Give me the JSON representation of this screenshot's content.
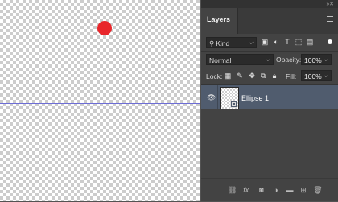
{
  "canvas": {
    "ellipse_color": "#e8262b",
    "guide_color": "#6d6dd6"
  },
  "panel": {
    "tab_label": "Layers",
    "collapse_icon": "double-chevron",
    "menu_icon": "hamburger-icon"
  },
  "filter": {
    "kind_label": "Kind",
    "icons": [
      "pixel-layer-filter-icon",
      "adjustment-layer-filter-icon",
      "type-layer-filter-icon",
      "shape-layer-filter-icon",
      "smart-object-filter-icon"
    ]
  },
  "blending": {
    "mode": "Normal",
    "opacity_label": "Opacity:",
    "opacity_value": "100%"
  },
  "lock": {
    "label": "Lock:",
    "fill_label": "Fill:",
    "fill_value": "100%"
  },
  "layers": [
    {
      "name": "Ellipse 1",
      "visible": true,
      "selected": true,
      "type": "shape"
    }
  ],
  "footer_icons": [
    "link-layers-icon",
    "fx-icon",
    "add-mask-icon",
    "adjustment-layer-icon",
    "new-group-icon",
    "new-layer-icon",
    "delete-icon"
  ],
  "footer_fx": "fx."
}
